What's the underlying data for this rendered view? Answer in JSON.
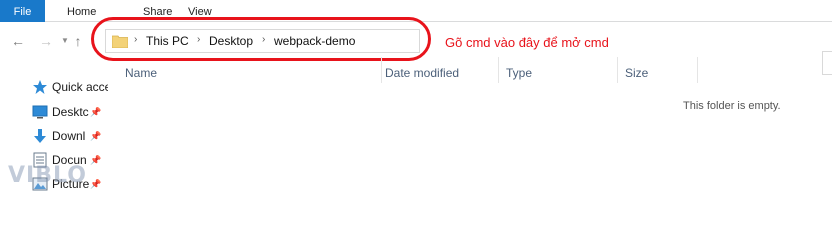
{
  "ribbon": {
    "tabs": [
      "File",
      "Home",
      "Share",
      "View"
    ]
  },
  "address": {
    "crumbs": [
      "This PC",
      "Desktop",
      "webpack-demo"
    ]
  },
  "annotation": "Gõ cmd vào đây để mở cmd",
  "columns": [
    "Name",
    "Date modified",
    "Type",
    "Size"
  ],
  "empty_message": "This folder is empty.",
  "nav_pane": {
    "items": [
      {
        "label": "Quick acce",
        "icon": "star-icon"
      },
      {
        "label": "Desktc",
        "icon": "desktop-icon"
      },
      {
        "label": "Downl",
        "icon": "download-icon"
      },
      {
        "label": "Docun",
        "icon": "document-icon"
      },
      {
        "label": "Picture",
        "icon": "picture-icon"
      }
    ]
  },
  "watermark": "VIBLO",
  "colors": {
    "file_tab": "#1979ca",
    "annotation": "#e8131b",
    "column_header": "#4c607a"
  }
}
